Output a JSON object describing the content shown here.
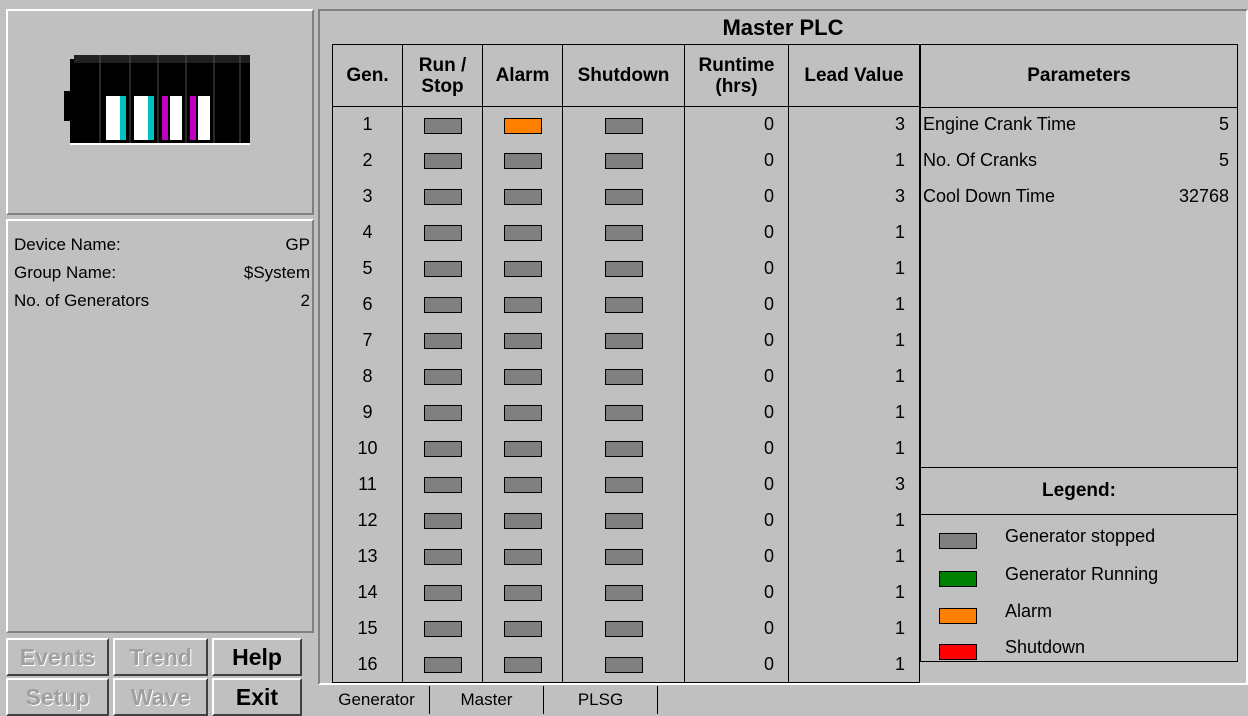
{
  "device": {
    "name_label": "Device Name:",
    "name_value": "GP",
    "group_label": "Group Name:",
    "group_value": "$System",
    "generators_label": "No. of Generators",
    "generators_value": "2"
  },
  "buttons": {
    "events": "Events",
    "trend": "Trend",
    "help": "Help",
    "setup": "Setup",
    "wave": "Wave",
    "exit": "Exit"
  },
  "main": {
    "title": "Master PLC",
    "columns": {
      "gen": "Gen.",
      "run_stop_1": "Run /",
      "run_stop_2": "Stop",
      "alarm": "Alarm",
      "shutdown": "Shutdown",
      "runtime_1": "Runtime",
      "runtime_2": "(hrs)",
      "lead": "Lead Value"
    },
    "rows": [
      {
        "gen": "1",
        "alarm": "orange",
        "runtime": "0",
        "lead": "3"
      },
      {
        "gen": "2",
        "alarm": "gray",
        "runtime": "0",
        "lead": "1"
      },
      {
        "gen": "3",
        "alarm": "gray",
        "runtime": "0",
        "lead": "3"
      },
      {
        "gen": "4",
        "alarm": "gray",
        "runtime": "0",
        "lead": "1"
      },
      {
        "gen": "5",
        "alarm": "gray",
        "runtime": "0",
        "lead": "1"
      },
      {
        "gen": "6",
        "alarm": "gray",
        "runtime": "0",
        "lead": "1"
      },
      {
        "gen": "7",
        "alarm": "gray",
        "runtime": "0",
        "lead": "1"
      },
      {
        "gen": "8",
        "alarm": "gray",
        "runtime": "0",
        "lead": "1"
      },
      {
        "gen": "9",
        "alarm": "gray",
        "runtime": "0",
        "lead": "1"
      },
      {
        "gen": "10",
        "alarm": "gray",
        "runtime": "0",
        "lead": "1"
      },
      {
        "gen": "11",
        "alarm": "gray",
        "runtime": "0",
        "lead": "3"
      },
      {
        "gen": "12",
        "alarm": "gray",
        "runtime": "0",
        "lead": "1"
      },
      {
        "gen": "13",
        "alarm": "gray",
        "runtime": "0",
        "lead": "1"
      },
      {
        "gen": "14",
        "alarm": "gray",
        "runtime": "0",
        "lead": "1"
      },
      {
        "gen": "15",
        "alarm": "gray",
        "runtime": "0",
        "lead": "1"
      },
      {
        "gen": "16",
        "alarm": "gray",
        "runtime": "0",
        "lead": "1"
      }
    ],
    "parameters": {
      "title": "Parameters",
      "items": [
        {
          "label": "Engine Crank Time",
          "value": "5"
        },
        {
          "label": "No. Of Cranks",
          "value": "5"
        },
        {
          "label": "Cool Down Time",
          "value": "32768"
        }
      ]
    },
    "legend": {
      "title": "Legend:",
      "items": [
        {
          "label": "Generator stopped",
          "color": "#808080"
        },
        {
          "label": "Generator Running",
          "color": "#008000"
        },
        {
          "label": "Alarm",
          "color": "#ff8000"
        },
        {
          "label": "Shutdown",
          "color": "#ff0000"
        }
      ]
    }
  },
  "tabs": [
    "Generator",
    "Master",
    "PLSG"
  ],
  "colors": {
    "gray": "#808080",
    "orange": "#ff8000",
    "green": "#008000",
    "red": "#ff0000"
  }
}
